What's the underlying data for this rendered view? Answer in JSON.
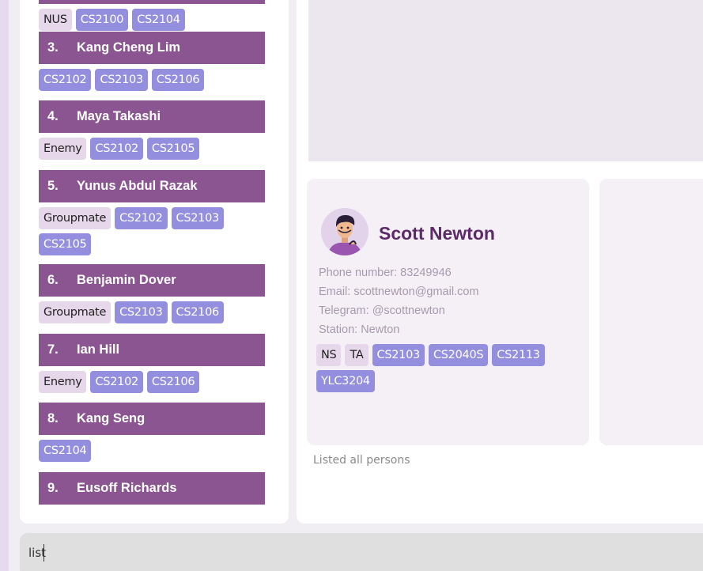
{
  "person_list": {
    "first_card_tags": [
      {
        "label": "NUS",
        "kind": "light"
      },
      {
        "label": "CS2100",
        "kind": "mod"
      },
      {
        "label": "CS2104",
        "kind": "mod"
      }
    ],
    "cards": [
      {
        "index": "3.",
        "name": "Kang Cheng Lim",
        "tags": [
          {
            "label": "CS2102",
            "kind": "mod"
          },
          {
            "label": "CS2103",
            "kind": "mod"
          },
          {
            "label": "CS2106",
            "kind": "mod"
          }
        ]
      },
      {
        "index": "4.",
        "name": "Maya Takashi",
        "tags": [
          {
            "label": "Enemy",
            "kind": "light"
          },
          {
            "label": "CS2102",
            "kind": "mod"
          },
          {
            "label": "CS2105",
            "kind": "mod"
          }
        ]
      },
      {
        "index": "5.",
        "name": "Yunus Abdul Razak",
        "tags": [
          {
            "label": "Groupmate",
            "kind": "light"
          },
          {
            "label": "CS2102",
            "kind": "mod"
          },
          {
            "label": "CS2103",
            "kind": "mod"
          },
          {
            "label": "CS2105",
            "kind": "mod"
          }
        ]
      },
      {
        "index": "6.",
        "name": "Benjamin Dover",
        "tags": [
          {
            "label": "Groupmate",
            "kind": "light"
          },
          {
            "label": "CS2103",
            "kind": "mod"
          },
          {
            "label": "CS2106",
            "kind": "mod"
          }
        ]
      },
      {
        "index": "7.",
        "name": "Ian Hill",
        "tags": [
          {
            "label": "Enemy",
            "kind": "light"
          },
          {
            "label": "CS2102",
            "kind": "mod"
          },
          {
            "label": "CS2106",
            "kind": "mod"
          }
        ]
      },
      {
        "index": "8.",
        "name": "Kang Seng",
        "tags": [
          {
            "label": "CS2104",
            "kind": "mod"
          }
        ]
      },
      {
        "index": "9.",
        "name": "Eusoff Richards",
        "tags": []
      }
    ]
  },
  "detail": {
    "name": "Scott Newton",
    "phone": "Phone number: 83249946",
    "email": "Email: scottnewton@gmail.com",
    "telegram": "Telegram: @scottnewton",
    "station": "Station: Newton",
    "tags": [
      {
        "label": "NS",
        "kind": "light"
      },
      {
        "label": "TA",
        "kind": "light"
      },
      {
        "label": "CS2103",
        "kind": "mod"
      },
      {
        "label": "CS2040S",
        "kind": "mod"
      },
      {
        "label": "CS2113",
        "kind": "mod"
      },
      {
        "label": "YLC3204",
        "kind": "mod"
      }
    ]
  },
  "status": "Listed all persons",
  "command": {
    "value": "list"
  },
  "colors": {
    "header": "#8a5590",
    "mod_tag": "#938fde",
    "light_tag": "#e6d7ea",
    "name_accent": "#5c2a68"
  }
}
